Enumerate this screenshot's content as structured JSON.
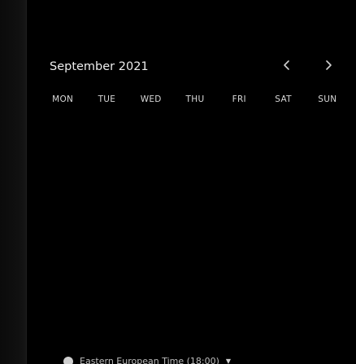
{
  "calendar": {
    "month_title": "September 2021",
    "prev_icon": "chevron-left-icon",
    "next_icon": "chevron-right-icon",
    "weekdays": [
      "MON",
      "TUE",
      "WED",
      "THU",
      "FRI",
      "SAT",
      "SUN"
    ]
  },
  "timezone": {
    "icon": "globe-icon",
    "label": "Eastern European Time (18:00)",
    "caret_icon": "caret-down-icon"
  },
  "colors": {
    "background": "#000000",
    "text": "#e6e6e6",
    "muted_text": "#bdbdbd"
  }
}
